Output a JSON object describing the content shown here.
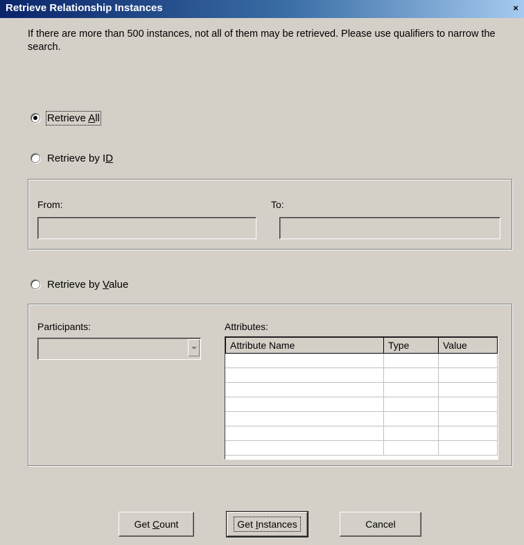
{
  "window": {
    "title": "Retrieve Relationship Instances",
    "close_glyph": "×"
  },
  "info_text": "If there are more than 500 instances, not all of them may be retrieved.  Please use qualifiers to narrow the search.",
  "options": {
    "retrieve_all": {
      "pre": "Retrieve ",
      "accel": "A",
      "post": "ll",
      "selected": true
    },
    "retrieve_by_id": {
      "pre": "Retrieve by I",
      "accel": "D",
      "post": "",
      "selected": false
    },
    "retrieve_by_value": {
      "pre": "Retrieve by ",
      "accel": "V",
      "post": "alue",
      "selected": false
    }
  },
  "id_group": {
    "from_label": "From:",
    "to_label": "To:",
    "from_value": "",
    "to_value": ""
  },
  "value_group": {
    "participants_label": "Participants:",
    "participants_value": "",
    "attributes_label": "Attributes:",
    "columns": [
      "Attribute Name",
      "Type",
      "Value"
    ],
    "rows": [
      [
        "",
        "",
        ""
      ],
      [
        "",
        "",
        ""
      ],
      [
        "",
        "",
        ""
      ],
      [
        "",
        "",
        ""
      ],
      [
        "",
        "",
        ""
      ],
      [
        "",
        "",
        ""
      ],
      [
        "",
        "",
        ""
      ]
    ]
  },
  "buttons": {
    "get_count": {
      "pre": "Get ",
      "accel": "C",
      "post": "ount"
    },
    "get_instances": {
      "pre": "Get ",
      "accel": "I",
      "post": "nstances"
    },
    "cancel": {
      "label": "Cancel"
    }
  }
}
